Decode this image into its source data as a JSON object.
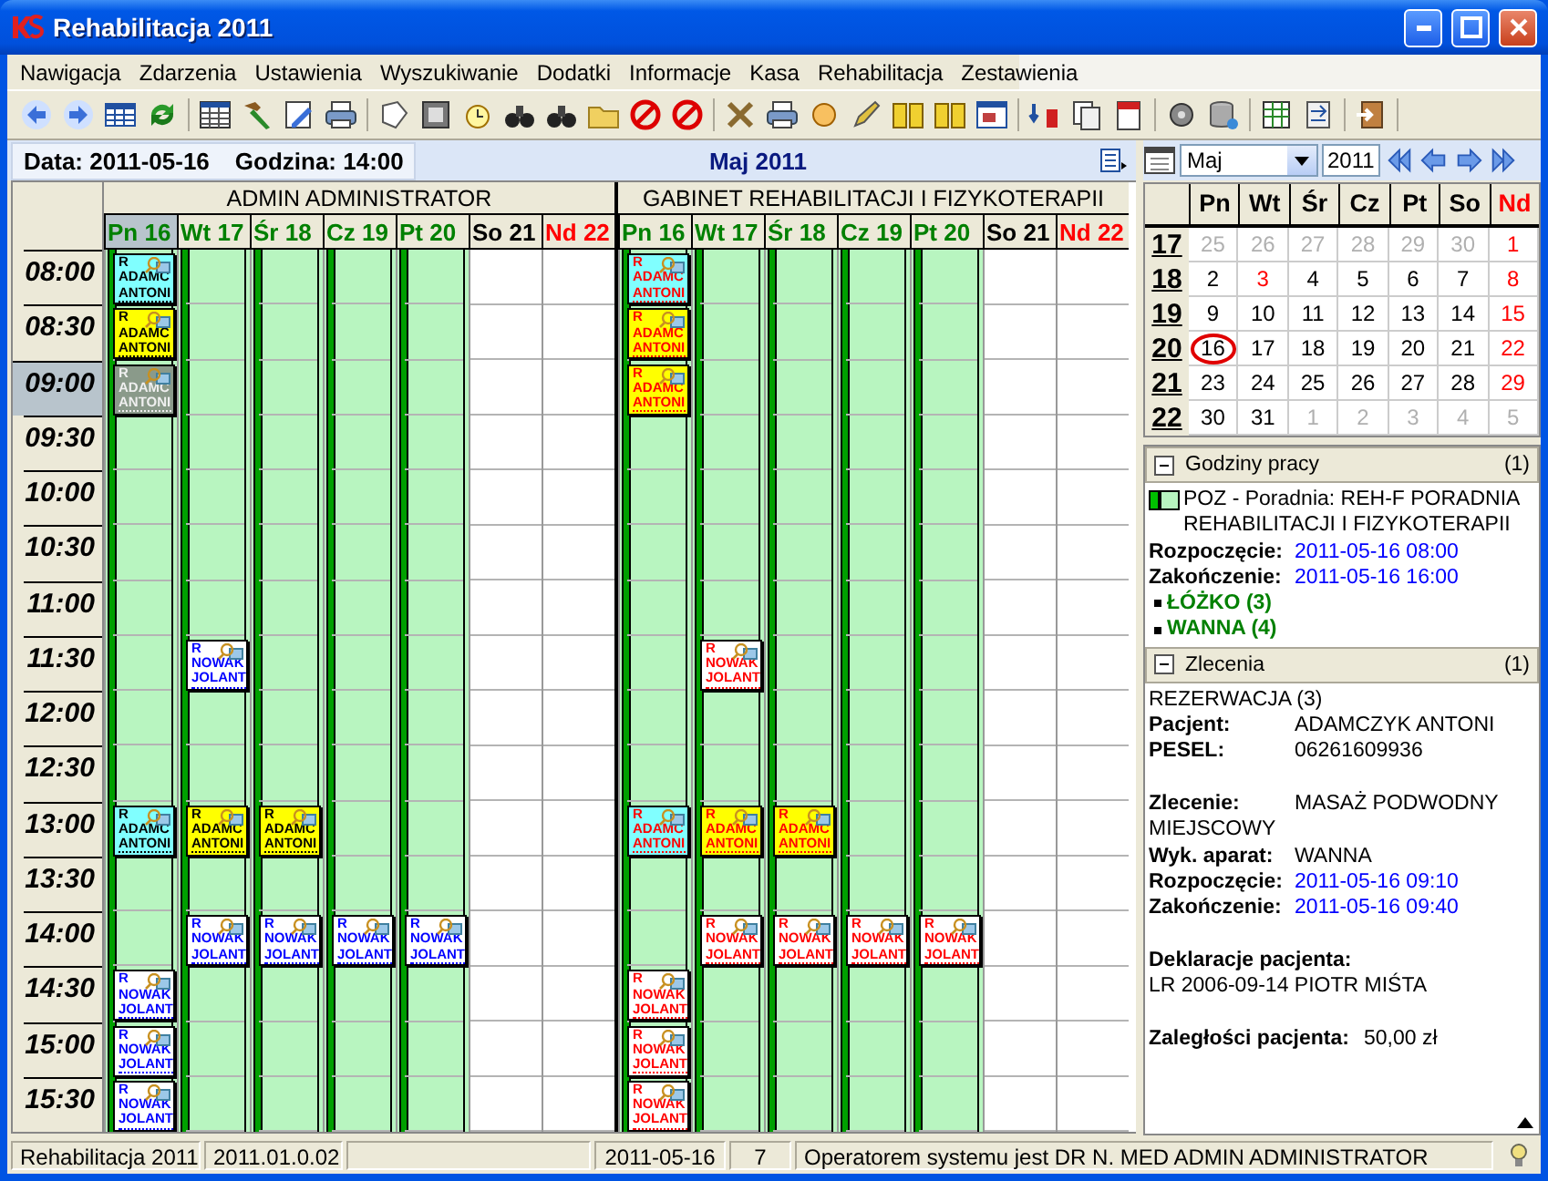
{
  "window": {
    "title": "Rehabilitacja 2011"
  },
  "menu": [
    "Nawigacja",
    "Zdarzenia",
    "Ustawienia",
    "Wyszukiwanie",
    "Dodatki",
    "Informacje",
    "Kasa",
    "Rehabilitacja",
    "Zestawienia"
  ],
  "date_bar": {
    "date": "Data: 2011-05-16",
    "time": "Godzina: 14:00",
    "month": "Maj 2011"
  },
  "schedule": {
    "times": [
      {
        "label": "08:00",
        "selected": false
      },
      {
        "label": "08:30",
        "selected": false
      },
      {
        "label": "09:00",
        "selected": true
      },
      {
        "label": "09:30",
        "selected": false
      },
      {
        "label": "10:00",
        "selected": false
      },
      {
        "label": "10:30",
        "selected": false
      },
      {
        "label": "11:00",
        "selected": false
      },
      {
        "label": "11:30",
        "selected": false
      },
      {
        "label": "12:00",
        "selected": false
      },
      {
        "label": "12:30",
        "selected": false
      },
      {
        "label": "13:00",
        "selected": false
      },
      {
        "label": "13:30",
        "selected": false
      },
      {
        "label": "14:00",
        "selected": false
      },
      {
        "label": "14:30",
        "selected": false
      },
      {
        "label": "15:00",
        "selected": false
      },
      {
        "label": "15:30",
        "selected": false
      }
    ],
    "groups": [
      {
        "name": "ADMIN ADMINISTRATOR",
        "days": [
          {
            "label": "Pn 16",
            "kind": "workday",
            "selected": true,
            "cells": [
              {
                "booked": true,
                "flag": "R",
                "surname": "ADAMC",
                "first_name": "ANTONI",
                "color": "#80ffff",
                "kind": "black_text"
              },
              {
                "booked": true,
                "flag": "R",
                "surname": "ADAMC",
                "first_name": "ANTONI",
                "color": "#ffff00",
                "kind": "black_text"
              },
              {
                "booked": true,
                "flag": "R",
                "surname": "ADAMC",
                "first_name": "ANTONI",
                "color": "#8a9a8a",
                "kind": "light_text"
              },
              {
                "booked": false
              },
              {
                "booked": false
              },
              {
                "booked": false
              },
              {
                "booked": false
              },
              {
                "booked": false
              },
              {
                "booked": false
              },
              {
                "booked": false
              },
              {
                "booked": true,
                "flag": "R",
                "surname": "ADAMC",
                "first_name": "ANTONI",
                "color": "#80ffff",
                "kind": "black_text"
              },
              {
                "booked": false
              },
              {
                "booked": false
              },
              {
                "booked": true,
                "flag": "R",
                "surname": "NOWAK",
                "first_name": "JOLANT",
                "color": "#ffffff",
                "kind": "blue_text"
              },
              {
                "booked": true,
                "flag": "R",
                "surname": "NOWAK",
                "first_name": "JOLANT",
                "color": "#ffffff",
                "kind": "blue_text"
              },
              {
                "booked": true,
                "flag": "R",
                "surname": "NOWAK",
                "first_name": "JOLANT",
                "color": "#ffffff",
                "kind": "blue_text"
              }
            ]
          },
          {
            "label": "Wt 17",
            "kind": "workday",
            "selected": false,
            "cells": [
              {
                "booked": false
              },
              {
                "booked": false
              },
              {
                "booked": false
              },
              {
                "booked": false
              },
              {
                "booked": false
              },
              {
                "booked": false
              },
              {
                "booked": false
              },
              {
                "booked": true,
                "flag": "R",
                "surname": "NOWAK",
                "first_name": "JOLANT",
                "color": "#ffffff",
                "kind": "blue_text"
              },
              {
                "booked": false
              },
              {
                "booked": false
              },
              {
                "booked": true,
                "flag": "R",
                "surname": "ADAMC",
                "first_name": "ANTONI",
                "color": "#ffff00",
                "kind": "black_text"
              },
              {
                "booked": false
              },
              {
                "booked": true,
                "flag": "R",
                "surname": "NOWAK",
                "first_name": "JOLANT",
                "color": "#ffffff",
                "kind": "blue_text"
              },
              {
                "booked": false
              },
              {
                "booked": false
              },
              {
                "booked": false
              }
            ]
          },
          {
            "label": "Śr 18",
            "kind": "workday",
            "selected": false,
            "cells": [
              {
                "booked": false
              },
              {
                "booked": false
              },
              {
                "booked": false
              },
              {
                "booked": false
              },
              {
                "booked": false
              },
              {
                "booked": false
              },
              {
                "booked": false
              },
              {
                "booked": false
              },
              {
                "booked": false
              },
              {
                "booked": false
              },
              {
                "booked": true,
                "flag": "R",
                "surname": "ADAMC",
                "first_name": "ANTONI",
                "color": "#ffff00",
                "kind": "black_text"
              },
              {
                "booked": false
              },
              {
                "booked": true,
                "flag": "R",
                "surname": "NOWAK",
                "first_name": "JOLANT",
                "color": "#ffffff",
                "kind": "blue_text"
              },
              {
                "booked": false
              },
              {
                "booked": false
              },
              {
                "booked": false
              }
            ]
          },
          {
            "label": "Cz 19",
            "kind": "workday",
            "selected": false,
            "cells": [
              {
                "booked": false
              },
              {
                "booked": false
              },
              {
                "booked": false
              },
              {
                "booked": false
              },
              {
                "booked": false
              },
              {
                "booked": false
              },
              {
                "booked": false
              },
              {
                "booked": false
              },
              {
                "booked": false
              },
              {
                "booked": false
              },
              {
                "booked": false
              },
              {
                "booked": false
              },
              {
                "booked": true,
                "flag": "R",
                "surname": "NOWAK",
                "first_name": "JOLANT",
                "color": "#ffffff",
                "kind": "blue_text"
              },
              {
                "booked": false
              },
              {
                "booked": false
              },
              {
                "booked": false
              }
            ]
          },
          {
            "label": "Pt 20",
            "kind": "workday",
            "selected": false,
            "cells": [
              {
                "booked": false
              },
              {
                "booked": false
              },
              {
                "booked": false
              },
              {
                "booked": false
              },
              {
                "booked": false
              },
              {
                "booked": false
              },
              {
                "booked": false
              },
              {
                "booked": false
              },
              {
                "booked": false
              },
              {
                "booked": false
              },
              {
                "booked": false
              },
              {
                "booked": false
              },
              {
                "booked": true,
                "flag": "R",
                "surname": "NOWAK",
                "first_name": "JOLANT",
                "color": "#ffffff",
                "kind": "blue_text"
              },
              {
                "booked": false
              },
              {
                "booked": false
              },
              {
                "booked": false
              }
            ]
          },
          {
            "label": "So 21",
            "kind": "saturday",
            "selected": false
          },
          {
            "label": "Nd 22",
            "kind": "sunday",
            "selected": false
          }
        ]
      },
      {
        "name": "GABINET REHABILITACJI I FIZYKOTERAPII",
        "days": [
          {
            "label": "Pn 16",
            "kind": "workday",
            "selected": false,
            "cells": [
              {
                "booked": true,
                "flag": "R",
                "surname": "ADAMC",
                "first_name": "ANTONI",
                "color": "#80ffff",
                "kind": "red_text"
              },
              {
                "booked": true,
                "flag": "R",
                "surname": "ADAMC",
                "first_name": "ANTONI",
                "color": "#ffff00",
                "kind": "red_text"
              },
              {
                "booked": true,
                "flag": "R",
                "surname": "ADAMC",
                "first_name": "ANTONI",
                "color": "#ffff00",
                "kind": "red_text"
              },
              {
                "booked": false
              },
              {
                "booked": false
              },
              {
                "booked": false
              },
              {
                "booked": false
              },
              {
                "booked": false
              },
              {
                "booked": false
              },
              {
                "booked": false
              },
              {
                "booked": true,
                "flag": "R",
                "surname": "ADAMC",
                "first_name": "ANTONI",
                "color": "#80ffff",
                "kind": "red_text"
              },
              {
                "booked": false
              },
              {
                "booked": false
              },
              {
                "booked": true,
                "flag": "R",
                "surname": "NOWAK",
                "first_name": "JOLANT",
                "color": "#ffffff",
                "kind": "red_text"
              },
              {
                "booked": true,
                "flag": "R",
                "surname": "NOWAK",
                "first_name": "JOLANT",
                "color": "#ffffff",
                "kind": "red_text"
              },
              {
                "booked": true,
                "flag": "R",
                "surname": "NOWAK",
                "first_name": "JOLANT",
                "color": "#ffffff",
                "kind": "red_text"
              }
            ]
          },
          {
            "label": "Wt 17",
            "kind": "workday",
            "selected": false,
            "cells": [
              {
                "booked": false
              },
              {
                "booked": false
              },
              {
                "booked": false
              },
              {
                "booked": false
              },
              {
                "booked": false
              },
              {
                "booked": false
              },
              {
                "booked": false
              },
              {
                "booked": true,
                "flag": "R",
                "surname": "NOWAK",
                "first_name": "JOLANT",
                "color": "#ffffff",
                "kind": "red_text"
              },
              {
                "booked": false
              },
              {
                "booked": false
              },
              {
                "booked": true,
                "flag": "R",
                "surname": "ADAMC",
                "first_name": "ANTONI",
                "color": "#ffff00",
                "kind": "red_text"
              },
              {
                "booked": false
              },
              {
                "booked": true,
                "flag": "R",
                "surname": "NOWAK",
                "first_name": "JOLANT",
                "color": "#ffffff",
                "kind": "red_text"
              },
              {
                "booked": false
              },
              {
                "booked": false
              },
              {
                "booked": false
              }
            ]
          },
          {
            "label": "Śr 18",
            "kind": "workday",
            "selected": false,
            "cells": [
              {
                "booked": false
              },
              {
                "booked": false
              },
              {
                "booked": false
              },
              {
                "booked": false
              },
              {
                "booked": false
              },
              {
                "booked": false
              },
              {
                "booked": false
              },
              {
                "booked": false
              },
              {
                "booked": false
              },
              {
                "booked": false
              },
              {
                "booked": true,
                "flag": "R",
                "surname": "ADAMC",
                "first_name": "ANTONI",
                "color": "#ffff00",
                "kind": "red_text"
              },
              {
                "booked": false
              },
              {
                "booked": true,
                "flag": "R",
                "surname": "NOWAK",
                "first_name": "JOLANT",
                "color": "#ffffff",
                "kind": "red_text"
              },
              {
                "booked": false
              },
              {
                "booked": false
              },
              {
                "booked": false
              }
            ]
          },
          {
            "label": "Cz 19",
            "kind": "workday",
            "selected": false,
            "cells": [
              {
                "booked": false
              },
              {
                "booked": false
              },
              {
                "booked": false
              },
              {
                "booked": false
              },
              {
                "booked": false
              },
              {
                "booked": false
              },
              {
                "booked": false
              },
              {
                "booked": false
              },
              {
                "booked": false
              },
              {
                "booked": false
              },
              {
                "booked": false
              },
              {
                "booked": false
              },
              {
                "booked": true,
                "flag": "R",
                "surname": "NOWAK",
                "first_name": "JOLANT",
                "color": "#ffffff",
                "kind": "red_text"
              },
              {
                "booked": false
              },
              {
                "booked": false
              },
              {
                "booked": false
              }
            ]
          },
          {
            "label": "Pt 20",
            "kind": "workday",
            "selected": false,
            "cells": [
              {
                "booked": false
              },
              {
                "booked": false
              },
              {
                "booked": false
              },
              {
                "booked": false
              },
              {
                "booked": false
              },
              {
                "booked": false
              },
              {
                "booked": false
              },
              {
                "booked": false
              },
              {
                "booked": false
              },
              {
                "booked": false
              },
              {
                "booked": false
              },
              {
                "booked": false
              },
              {
                "booked": true,
                "flag": "R",
                "surname": "NOWAK",
                "first_name": "JOLANT",
                "color": "#ffffff",
                "kind": "red_text"
              },
              {
                "booked": false
              },
              {
                "booked": false
              },
              {
                "booked": false
              }
            ]
          },
          {
            "label": "So 21",
            "kind": "saturday",
            "selected": false
          },
          {
            "label": "Nd 22",
            "kind": "sunday",
            "selected": false
          }
        ]
      }
    ]
  },
  "calendar": {
    "month": "Maj",
    "year": "2011",
    "weekdays": [
      {
        "label": "Pn",
        "kind": "normal"
      },
      {
        "label": "Wt",
        "kind": "normal"
      },
      {
        "label": "Śr",
        "kind": "normal"
      },
      {
        "label": "Cz",
        "kind": "normal"
      },
      {
        "label": "Pt",
        "kind": "normal"
      },
      {
        "label": "So",
        "kind": "normal"
      },
      {
        "label": "Nd",
        "kind": "holiday"
      }
    ],
    "weeks": [
      {
        "number": "17",
        "days": [
          {
            "label": "25",
            "kind": "other",
            "selected": false
          },
          {
            "label": "26",
            "kind": "other",
            "selected": false
          },
          {
            "label": "27",
            "kind": "other",
            "selected": false
          },
          {
            "label": "28",
            "kind": "other",
            "selected": false
          },
          {
            "label": "29",
            "kind": "other",
            "selected": false
          },
          {
            "label": "30",
            "kind": "other",
            "selected": false
          },
          {
            "label": "1",
            "kind": "holiday",
            "selected": false
          }
        ]
      },
      {
        "number": "18",
        "days": [
          {
            "label": "2",
            "kind": "normal",
            "selected": false
          },
          {
            "label": "3",
            "kind": "holiday",
            "selected": false
          },
          {
            "label": "4",
            "kind": "normal",
            "selected": false
          },
          {
            "label": "5",
            "kind": "normal",
            "selected": false
          },
          {
            "label": "6",
            "kind": "normal",
            "selected": false
          },
          {
            "label": "7",
            "kind": "normal",
            "selected": false
          },
          {
            "label": "8",
            "kind": "holiday",
            "selected": false
          }
        ]
      },
      {
        "number": "19",
        "days": [
          {
            "label": "9",
            "kind": "normal",
            "selected": false
          },
          {
            "label": "10",
            "kind": "normal",
            "selected": false
          },
          {
            "label": "11",
            "kind": "normal",
            "selected": false
          },
          {
            "label": "12",
            "kind": "normal",
            "selected": false
          },
          {
            "label": "13",
            "kind": "normal",
            "selected": false
          },
          {
            "label": "14",
            "kind": "normal",
            "selected": false
          },
          {
            "label": "15",
            "kind": "holiday",
            "selected": false
          }
        ]
      },
      {
        "number": "20",
        "days": [
          {
            "label": "16",
            "kind": "normal",
            "selected": true
          },
          {
            "label": "17",
            "kind": "normal",
            "selected": false
          },
          {
            "label": "18",
            "kind": "normal",
            "selected": false
          },
          {
            "label": "19",
            "kind": "normal",
            "selected": false
          },
          {
            "label": "20",
            "kind": "normal",
            "selected": false
          },
          {
            "label": "21",
            "kind": "normal",
            "selected": false
          },
          {
            "label": "22",
            "kind": "holiday",
            "selected": false
          }
        ]
      },
      {
        "number": "21",
        "days": [
          {
            "label": "23",
            "kind": "normal",
            "selected": false
          },
          {
            "label": "24",
            "kind": "normal",
            "selected": false
          },
          {
            "label": "25",
            "kind": "normal",
            "selected": false
          },
          {
            "label": "26",
            "kind": "normal",
            "selected": false
          },
          {
            "label": "27",
            "kind": "normal",
            "selected": false
          },
          {
            "label": "28",
            "kind": "normal",
            "selected": false
          },
          {
            "label": "29",
            "kind": "holiday",
            "selected": false
          }
        ]
      },
      {
        "number": "22",
        "days": [
          {
            "label": "30",
            "kind": "normal",
            "selected": false
          },
          {
            "label": "31",
            "kind": "normal",
            "selected": false
          },
          {
            "label": "1",
            "kind": "other",
            "selected": false
          },
          {
            "label": "2",
            "kind": "other",
            "selected": false
          },
          {
            "label": "3",
            "kind": "other",
            "selected": false
          },
          {
            "label": "4",
            "kind": "other",
            "selected": false
          },
          {
            "label": "5",
            "kind": "other",
            "selected": false
          }
        ]
      }
    ]
  },
  "details": [
    {
      "title": "Godziny pracy",
      "count": "(1)",
      "expanded": true,
      "items": [
        {
          "kind": "clinic",
          "text": "POZ - Poradnia: REH-F PORADNIA REHABILITACJI I FIZYKOTERAPII"
        },
        {
          "kind": "time_field",
          "label": "Rozpoczęcie:",
          "value": "2011-05-16 08:00",
          "gap_before": false
        },
        {
          "kind": "time_field",
          "label": "Zakończenie:",
          "value": "2011-05-16 16:00",
          "gap_before": false
        },
        {
          "kind": "resource",
          "text": "ŁÓŻKO (3)"
        },
        {
          "kind": "resource",
          "text": "WANNA (4)"
        }
      ]
    },
    {
      "title": "Zlecenia",
      "count": "(1)",
      "expanded": true,
      "items": [
        {
          "kind": "text",
          "text": "REZERWACJA (3)",
          "gap_before": false
        },
        {
          "kind": "field",
          "label": "Pacjent:",
          "value": "ADAMCZYK ANTONI",
          "gap_before": false
        },
        {
          "kind": "field",
          "label": "PESEL:",
          "value": "06261609936",
          "gap_before": false
        },
        {
          "kind": "field",
          "label": "Zlecenie:",
          "value": "MASAŻ PODWODNY MIEJSCOWY",
          "gap_before": true
        },
        {
          "kind": "field",
          "label": "Wyk. aparat:",
          "value": "WANNA",
          "gap_before": false
        },
        {
          "kind": "time_field",
          "label": "Rozpoczęcie:",
          "value": "2011-05-16 09:10",
          "gap_before": false
        },
        {
          "kind": "time_field",
          "label": "Zakończenie:",
          "value": "2011-05-16 09:40",
          "gap_before": false
        },
        {
          "kind": "heading",
          "text": "Deklaracje pacjenta:",
          "gap_before": true
        },
        {
          "kind": "text",
          "text": "LR 2006-09-14 PIOTR MIŚTA",
          "gap_before": false
        },
        {
          "kind": "wide_field",
          "label": "Zaległości pacjenta:",
          "value": "50,00 zł",
          "gap_before": true
        }
      ]
    }
  ],
  "status_bar": {
    "app": "Rehabilitacja 2011",
    "version": "2011.01.0.02",
    "date": "2011-05-16",
    "number": "7",
    "message": "Operatorem systemu jest DR N. MED ADMIN ADMINISTRATOR"
  }
}
